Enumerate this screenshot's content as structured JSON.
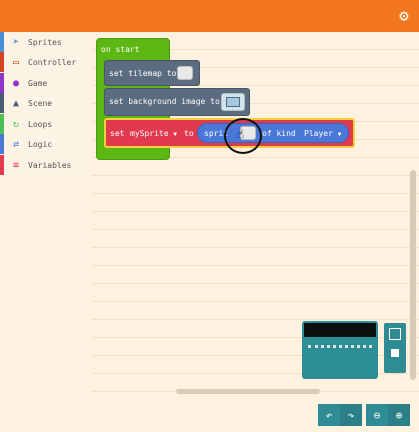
{
  "toolbox": {
    "categories": [
      {
        "label": "Sprites",
        "color": "#4a90d9",
        "icon": "paper-plane-icon"
      },
      {
        "label": "Controller",
        "color": "#d54322",
        "icon": "gamepad-icon"
      },
      {
        "label": "Game",
        "color": "#8f35c9",
        "icon": "circle-icon"
      },
      {
        "label": "Scene",
        "color": "#4b5a75",
        "icon": "tree-icon"
      },
      {
        "label": "Loops",
        "color": "#4cbf56",
        "icon": "loop-icon"
      },
      {
        "label": "Logic",
        "color": "#4a78d8",
        "icon": "shuffle-icon"
      },
      {
        "label": "Variables",
        "color": "#e13a4f",
        "icon": "list-icon"
      }
    ]
  },
  "blocks": {
    "on_start": "on start",
    "set_tilemap": "set tilemap to",
    "set_background": "set background image to",
    "set_label": "set",
    "var_name": "mySprite",
    "to_label": "to",
    "sprite_label": "sprit",
    "of_kind": "of kind",
    "kind_value": "Player"
  },
  "colors": {
    "topbar": "#f1761c",
    "events": "#5cb712",
    "scene": "#5b6b80",
    "variables": "#e13a4f",
    "sprites": "#4a78d8",
    "simulator": "#2f8b94"
  }
}
